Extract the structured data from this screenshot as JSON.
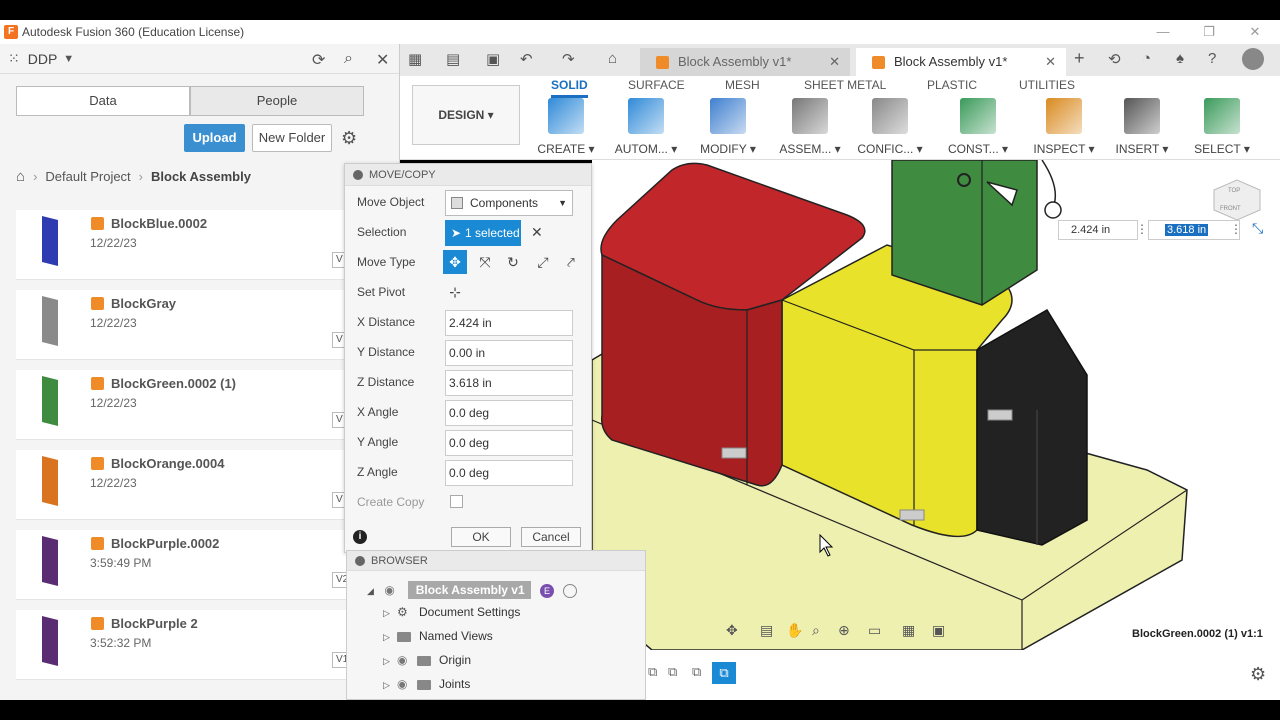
{
  "window": {
    "title": "Autodesk Fusion 360 (Education License)",
    "controls": [
      "—",
      "❐",
      "✕"
    ]
  },
  "data_panel": {
    "project_name": "DDP",
    "tabs": [
      {
        "label": "Data",
        "active": true
      },
      {
        "label": "People",
        "active": false
      }
    ],
    "upload_label": "Upload",
    "new_folder_label": "New Folder",
    "breadcrumb": [
      "Default Project",
      "Block Assembly"
    ],
    "files": [
      {
        "name": "BlockBlue.0002",
        "date": "12/22/23",
        "version": "V",
        "color": "#2f3bb0"
      },
      {
        "name": "BlockGray",
        "date": "12/22/23",
        "version": "V",
        "color": "#8a8a8a"
      },
      {
        "name": "BlockGreen.0002 (1)",
        "date": "12/22/23",
        "version": "V",
        "color": "#3f8b3f"
      },
      {
        "name": "BlockOrange.0004",
        "date": "12/22/23",
        "version": "V",
        "color": "#d9731f"
      },
      {
        "name": "BlockPurple.0002",
        "date": "3:59:49 PM",
        "version": "V2",
        "color": "#5a2d72"
      },
      {
        "name": "BlockPurple 2",
        "date": "3:52:32 PM",
        "version": "V1",
        "color": "#5a2d72"
      }
    ]
  },
  "doc_tabs": [
    {
      "label": "Block Assembly v1*",
      "active": false
    },
    {
      "label": "Block Assembly v1*",
      "active": true
    }
  ],
  "ribbon": {
    "workspace": "DESIGN ▾",
    "tabs": [
      {
        "label": "SOLID",
        "active": true
      },
      {
        "label": "SURFACE",
        "active": false
      },
      {
        "label": "MESH",
        "active": false
      },
      {
        "label": "SHEET METAL",
        "active": false
      },
      {
        "label": "PLASTIC",
        "active": false
      },
      {
        "label": "UTILITIES",
        "active": false
      }
    ],
    "groups": [
      {
        "label": "CREATE ▾",
        "color": "#2f8ad8"
      },
      {
        "label": "AUTOM... ▾",
        "color": "#2f8ad8"
      },
      {
        "label": "MODIFY ▾",
        "color": "#3f7fcf"
      },
      {
        "label": "ASSEM... ▾",
        "color": "#777777"
      },
      {
        "label": "CONFIC... ▾",
        "color": "#888888"
      },
      {
        "label": "CONST... ▾",
        "color": "#3a9a5a"
      },
      {
        "label": "INSPECT ▾",
        "color": "#d98a1f"
      },
      {
        "label": "INSERT ▾",
        "color": "#555555"
      },
      {
        "label": "SELECT ▾",
        "color": "#3a9a5a"
      }
    ]
  },
  "move_copy": {
    "title": "MOVE/COPY",
    "move_object_label": "Move Object",
    "move_object_value": "Components",
    "selection_label": "Selection",
    "selection_value": "1 selected",
    "move_type_label": "Move Type",
    "set_pivot_label": "Set Pivot",
    "fields": [
      {
        "label": "X Distance",
        "value": "2.424 in"
      },
      {
        "label": "Y Distance",
        "value": "0.00 in"
      },
      {
        "label": "Z Distance",
        "value": "3.618 in"
      },
      {
        "label": "X Angle",
        "value": "0.0 deg"
      },
      {
        "label": "Y Angle",
        "value": "0.0 deg"
      },
      {
        "label": "Z Angle",
        "value": "0.0 deg"
      }
    ],
    "create_copy_label": "Create Copy",
    "ok_label": "OK",
    "cancel_label": "Cancel"
  },
  "browser": {
    "title": "BROWSER",
    "root": "Block Assembly v1",
    "items": [
      {
        "label": "Document Settings",
        "kind": "settings"
      },
      {
        "label": "Named Views",
        "kind": "folder"
      },
      {
        "label": "Origin",
        "kind": "folder"
      },
      {
        "label": "Joints",
        "kind": "folder"
      }
    ]
  },
  "viewport": {
    "dim_x": "2.424 in",
    "dim_z": "3.618 in",
    "document_label": "BlockGreen.0002 (1) v1:1",
    "viewcube_top": "TOP",
    "viewcube_front": "FRONT",
    "colors": {
      "red": "#c0262a",
      "yellow": "#e8e22a",
      "black": "#222222",
      "green": "#3f8b3f",
      "base": "#eef0b0"
    }
  }
}
